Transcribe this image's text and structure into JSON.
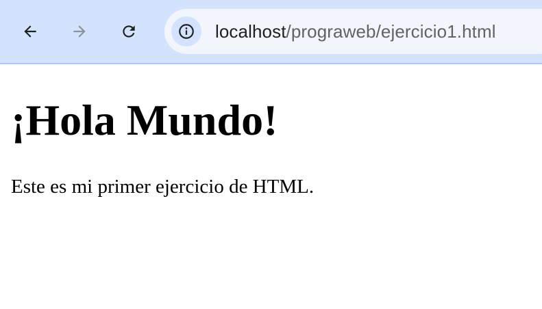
{
  "browser": {
    "url_host": "localhost",
    "url_path": "/prograweb/ejercicio1.html",
    "icons": {
      "back": "arrow-left-icon",
      "forward": "arrow-right-icon",
      "reload": "reload-icon",
      "site_info": "info-icon"
    },
    "colors": {
      "toolbar": "#d3e3fd",
      "omnibox": "#f2f6fc",
      "forward_disabled": "#8e9199"
    }
  },
  "page": {
    "heading": "¡Hola Mundo!",
    "paragraph": "Este es mi primer ejercicio de HTML."
  }
}
